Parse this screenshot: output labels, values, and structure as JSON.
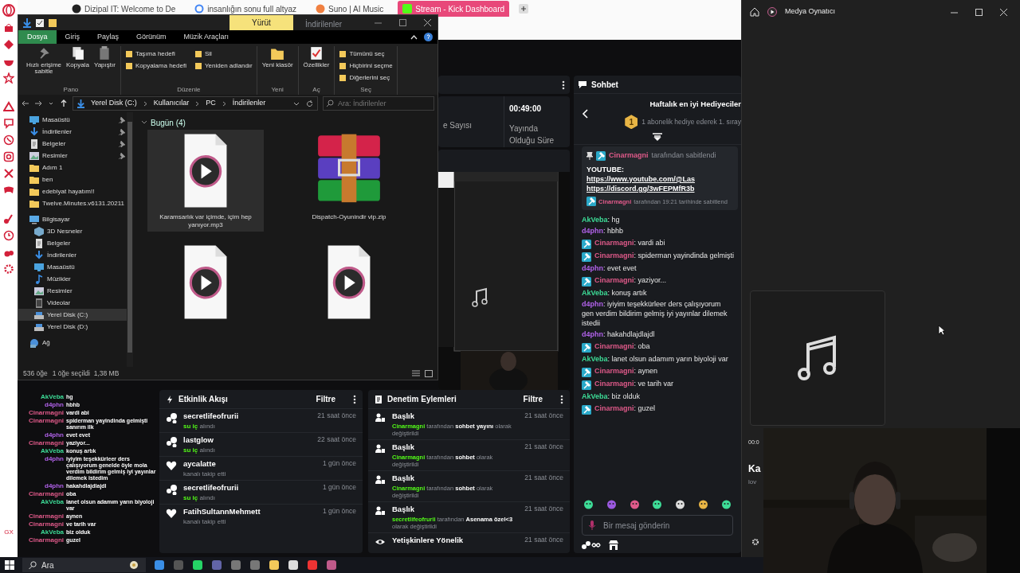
{
  "browser": {
    "tabs": [
      {
        "title": "Dizipal IT: Welcome to De",
        "selected": false
      },
      {
        "title": "insanlığın sonu full altyaz",
        "selected": false
      },
      {
        "title": "Suno | AI Music",
        "selected": false
      },
      {
        "title": "Stream - Kick Dashboard",
        "selected": true
      }
    ],
    "sidebar_footer": "GX"
  },
  "explorer": {
    "context_tab": "Yürüt",
    "title": "İndirilenler",
    "ribbon_tabs": [
      {
        "label": "Dosya",
        "selected": true
      },
      {
        "label": "Giriş",
        "selected": false
      },
      {
        "label": "Paylaş",
        "selected": false
      },
      {
        "label": "Görünüm",
        "selected": false
      },
      {
        "label": "Müzik Araçları",
        "selected": false
      }
    ],
    "ribbon_groups": [
      {
        "label": "Pano",
        "buttons": [
          {
            "label": "Hızlı erişime sabitle",
            "kind": "large"
          },
          {
            "label": "Kopyala",
            "kind": "large"
          },
          {
            "label": "Yapıştır",
            "kind": "large"
          }
        ]
      },
      {
        "label": "Düzenle",
        "buttons": [
          {
            "label": "Taşıma hedefi",
            "kind": "small"
          },
          {
            "label": "Kopyalama hedefi",
            "kind": "small"
          },
          {
            "label": "Sil",
            "kind": "small"
          },
          {
            "label": "Yeniden adlandır",
            "kind": "small"
          }
        ]
      },
      {
        "label": "Yeni",
        "buttons": [
          {
            "label": "Yeni klasör",
            "kind": "large"
          }
        ]
      },
      {
        "label": "Aç",
        "buttons": [
          {
            "label": "Özellikler",
            "kind": "large"
          }
        ]
      },
      {
        "label": "Seç",
        "buttons": [
          {
            "label": "Tümünü seç",
            "kind": "small"
          },
          {
            "label": "Hiçbirini seçme",
            "kind": "small"
          },
          {
            "label": "Diğerlerini seç",
            "kind": "small"
          }
        ]
      }
    ],
    "breadcrumb": [
      "Yerel Disk (C:)",
      "Kullanıcılar",
      "PC",
      "İndirilenler"
    ],
    "search": {
      "placeholder": "Ara: İndirilenler"
    },
    "nav": [
      {
        "label": "Masaüstü",
        "kind": "desktop",
        "pinned": true,
        "selected": false
      },
      {
        "label": "İndirilenler",
        "kind": "download",
        "pinned": true,
        "selected": false
      },
      {
        "label": "Belgeler",
        "kind": "document",
        "pinned": true,
        "selected": false
      },
      {
        "label": "Resimler",
        "kind": "pictures",
        "pinned": true,
        "selected": false
      },
      {
        "label": "Adım 1",
        "kind": "folder",
        "pinned": false,
        "selected": false
      },
      {
        "label": "ben",
        "kind": "folder",
        "pinned": false,
        "selected": false
      },
      {
        "label": "edebiyat hayatım!!",
        "kind": "folder",
        "pinned": false,
        "selected": false
      },
      {
        "label": "Twelve.Minutes.v6131.20211",
        "kind": "folder",
        "pinned": false,
        "selected": false
      },
      {
        "label": "Bilgisayar",
        "kind": "computer",
        "pinned": false,
        "selected": false,
        "children": [
          {
            "label": "3D Nesneler",
            "kind": "objects",
            "pinned": false,
            "selected": false
          },
          {
            "label": "Belgeler",
            "kind": "document",
            "pinned": false,
            "selected": false
          },
          {
            "label": "İndirilenler",
            "kind": "download",
            "pinned": false,
            "selected": false
          },
          {
            "label": "Masaüstü",
            "kind": "desktop",
            "pinned": false,
            "selected": false
          },
          {
            "label": "Müzikler",
            "kind": "music",
            "pinned": false,
            "selected": false
          },
          {
            "label": "Resimler",
            "kind": "pictures",
            "pinned": false,
            "selected": false
          },
          {
            "label": "Videolar",
            "kind": "videos",
            "pinned": false,
            "selected": false
          },
          {
            "label": "Yerel Disk (C:)",
            "kind": "drive",
            "pinned": false,
            "selected": true
          },
          {
            "label": "Yerel Disk (D:)",
            "kind": "drive",
            "pinned": false,
            "selected": false
          }
        ]
      },
      {
        "label": "Ağ",
        "kind": "network",
        "pinned": false,
        "selected": false
      }
    ],
    "group": "Bugün (4)",
    "files": [
      {
        "name": "Karamsarlık var içimde, içim hep yanıyor.mp3",
        "kind": "audio",
        "selected": true
      },
      {
        "name": "Dispatch-Oyunindir vip.zip",
        "kind": "archive",
        "selected": false
      },
      {
        "kind": "audio",
        "selected": false
      },
      {
        "kind": "audio",
        "selected": false
      }
    ],
    "status": [
      "536 öğe",
      "1 öğe seçildi  1,38 MB"
    ]
  },
  "dashboard": {
    "stats": [
      {
        "label": "e Sayısı"
      },
      {
        "value": "00:49:00",
        "label": "Yayında Olduğu Süre"
      }
    ],
    "overlay_chat": [
      {
        "user": "AkVeba",
        "color": "#3ddc97",
        "text": "hg"
      },
      {
        "user": "d4phn",
        "color": "#b061e9",
        "text": "hbhb"
      },
      {
        "user": "Cinarmagni",
        "color": "#e05a8a",
        "text": "vardi abi"
      },
      {
        "user": "Cinarmagni",
        "color": "#e05a8a",
        "text": "spiderman yayindinda gelmişti sanırım ilk"
      },
      {
        "user": "d4phn",
        "color": "#b061e9",
        "text": "evet evet"
      },
      {
        "user": "Cinarmagni",
        "color": "#e05a8a",
        "text": "yaziyor..."
      },
      {
        "user": "AkVeba",
        "color": "#3ddc97",
        "text": "konuş artık"
      },
      {
        "user": "d4phn",
        "color": "#b061e9",
        "text": "iyiyim teşekkürleer ders çalışıyorum genelde öyle mola verdim bildirim gelmiş iyi yayınlar dilemek istedim"
      },
      {
        "user": "d4phn",
        "color": "#b061e9",
        "text": "hakahdlajdlajdl"
      },
      {
        "user": "Cinarmagni",
        "color": "#e05a8a",
        "text": "oba"
      },
      {
        "user": "AkVeba",
        "color": "#3ddc97",
        "text": "lanet olsun adamım yarın biyoloji var"
      },
      {
        "user": "Cinarmagni",
        "color": "#e05a8a",
        "text": "aynen"
      },
      {
        "user": "Cinarmagni",
        "color": "#e05a8a",
        "text": "ve tarih var"
      },
      {
        "user": "AkVeba",
        "color": "#3ddc97",
        "text": "biz olduk"
      },
      {
        "user": "Cinarmagni",
        "color": "#e05a8a",
        "text": "guzel"
      }
    ],
    "events": {
      "title": "Etkinlik Akışı",
      "filter": "Filtre",
      "items": [
        {
          "kind": "gift",
          "user": "secretlifeofrurii",
          "reward": "su iç",
          "action": "alındı",
          "time": "21 saat önce"
        },
        {
          "kind": "gift",
          "user": "lastglow",
          "reward": "su iç",
          "action": "alındı",
          "time": "22 saat önce"
        },
        {
          "kind": "follow",
          "user": "aycalatte",
          "action": "kanalı takip etti",
          "time": "1 gün önce"
        },
        {
          "kind": "gift",
          "user": "secretlifeofrurii",
          "reward": "su iç",
          "action": "alındı",
          "time": "1 gün önce"
        },
        {
          "kind": "follow",
          "user": "FatihSultannMehmett",
          "action": "kanalı takip etti",
          "time": "1 gün önce"
        }
      ]
    },
    "moderation": {
      "title": "Denetim Eylemleri",
      "filter": "Filtre",
      "items": [
        {
          "kind": "title",
          "title": "Başlık",
          "actor": "Cinarmagni",
          "by": "tarafından",
          "value": "sohbet yayını",
          "suffix": "olarak değiştirildi",
          "time": "21 saat önce"
        },
        {
          "kind": "title",
          "title": "Başlık",
          "actor": "Cinarmagni",
          "by": "tarafından",
          "value": "sohbet",
          "suffix": "olarak değiştirildi",
          "time": "21 saat önce"
        },
        {
          "kind": "title",
          "title": "Başlık",
          "actor": "Cinarmagni",
          "by": "tarafından",
          "value": "sohbet",
          "suffix": "olarak değiştirildi",
          "time": "21 saat önce"
        },
        {
          "kind": "title",
          "title": "Başlık",
          "actor": "secretlifeofrurii",
          "by": "tarafından",
          "value": "Asenama özel<3",
          "suffix": "olarak değiştirildi",
          "time": "21 saat önce"
        },
        {
          "kind": "mature",
          "title": "Yetişkinlere Yönelik",
          "time": "21 saat önce"
        }
      ]
    }
  },
  "chat": {
    "title": "Sohbet",
    "leaderboard": {
      "title": "Haftalık en iyi Hediyeciler",
      "rank": "1",
      "text": "1 abonelik hediye ederek 1. sıray"
    },
    "pinned": {
      "by": "Cinarmagni",
      "note": "tarafından sabitlendi",
      "label": "YOUTUBE:",
      "links": [
        "https://www.youtube.com/@Las",
        "https://discord.gg/3wFEPMfR3b"
      ],
      "footer_by": "Cinarmagni",
      "footer": "tarafından 19:21 tarihinde sabitlend"
    },
    "separator": ":",
    "messages": [
      {
        "user": "AkVeba",
        "color": "#3ddc97",
        "moderator": false,
        "text": "hg"
      },
      {
        "user": "d4phn",
        "color": "#b061e9",
        "moderator": false,
        "text": "hbhb"
      },
      {
        "user": "Cinarmagni",
        "color": "#e05a8a",
        "moderator": true,
        "text": "vardi abi"
      },
      {
        "user": "Cinarmagni",
        "color": "#e05a8a",
        "moderator": true,
        "text": "spiderman yayindinda gelmişti"
      },
      {
        "user": "d4phn",
        "color": "#b061e9",
        "moderator": false,
        "text": "evet evet"
      },
      {
        "user": "Cinarmagni",
        "color": "#e05a8a",
        "moderator": true,
        "text": "yaziyor..."
      },
      {
        "user": "AkVeba",
        "color": "#3ddc97",
        "moderator": false,
        "text": "konuş artık"
      },
      {
        "user": "d4phn",
        "color": "#b061e9",
        "moderator": false,
        "text": "iyiyim teşekkürleer ders çalışıyorum gen verdim bildirim gelmiş iyi yayınlar dilemek istedii"
      },
      {
        "user": "d4phn",
        "color": "#b061e9",
        "moderator": false,
        "text": "hakahdlajdlajdl"
      },
      {
        "user": "Cinarmagni",
        "color": "#e05a8a",
        "moderator": true,
        "text": "oba"
      },
      {
        "user": "AkVeba",
        "color": "#3ddc97",
        "moderator": false,
        "text": "lanet olsun adamım yarın biyoloji var"
      },
      {
        "user": "Cinarmagni",
        "color": "#e05a8a",
        "moderator": true,
        "text": "aynen"
      },
      {
        "user": "Cinarmagni",
        "color": "#e05a8a",
        "moderator": true,
        "text": "ve tarih var"
      },
      {
        "user": "AkVeba",
        "color": "#3ddc97",
        "moderator": false,
        "text": "biz olduk"
      },
      {
        "user": "Cinarmagni",
        "color": "#e05a8a",
        "moderator": true,
        "text": "guzel"
      }
    ],
    "input": {
      "placeholder": "Bir mesaj gönderin"
    }
  },
  "media_player": {
    "title": "Medya Oynatıcı",
    "time": "00:0",
    "track_title": "Ka",
    "artist": "lov"
  },
  "taskbar": {
    "search": "Ara"
  }
}
